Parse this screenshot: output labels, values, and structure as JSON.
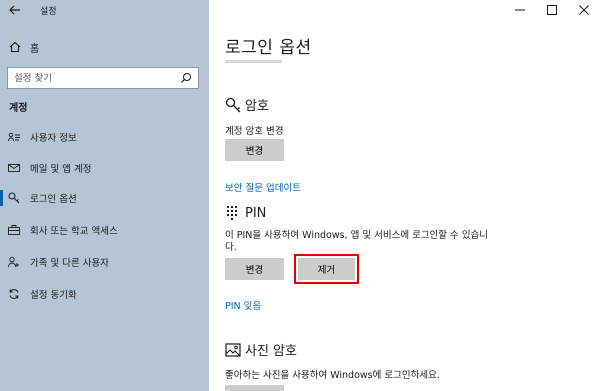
{
  "window": {
    "title": "설정"
  },
  "sidebar": {
    "home_label": "홈",
    "search_placeholder": "설정 찾기",
    "section_label": "계정",
    "items": [
      {
        "label": "사용자 정보",
        "icon": "person-card-icon"
      },
      {
        "label": "메일 및 앱 계정",
        "icon": "mail-icon"
      },
      {
        "label": "로그인 옵션",
        "icon": "key-icon",
        "active": true
      },
      {
        "label": "회사 또는 학교 액세스",
        "icon": "briefcase-icon"
      },
      {
        "label": "가족 및 다른 사용자",
        "icon": "people-icon"
      },
      {
        "label": "설정 동기화",
        "icon": "sync-icon"
      }
    ]
  },
  "main": {
    "title": "로그인 옵션",
    "password": {
      "heading": "암호",
      "description": "계정 암호 변경",
      "change_button": "변경",
      "security_link": "보안 질문 업데이트"
    },
    "pin": {
      "heading": "PIN",
      "description_line1": "이 PIN을 사용하여 Windows, 앱 및 서비스에 로그인할 수 있습니",
      "description_line2": "다.",
      "change_button": "변경",
      "remove_button": "제거",
      "forgot_link": "PIN 잊음"
    },
    "picture": {
      "heading": "사진 암호",
      "description": "좋아하는 사진을 사용하여 Windows에 로그인하세요."
    }
  },
  "colors": {
    "sidebar_bg": "#b5c5d6",
    "accent": "#0063b1",
    "highlight": "#e00000",
    "button_bg": "#cccccc"
  }
}
